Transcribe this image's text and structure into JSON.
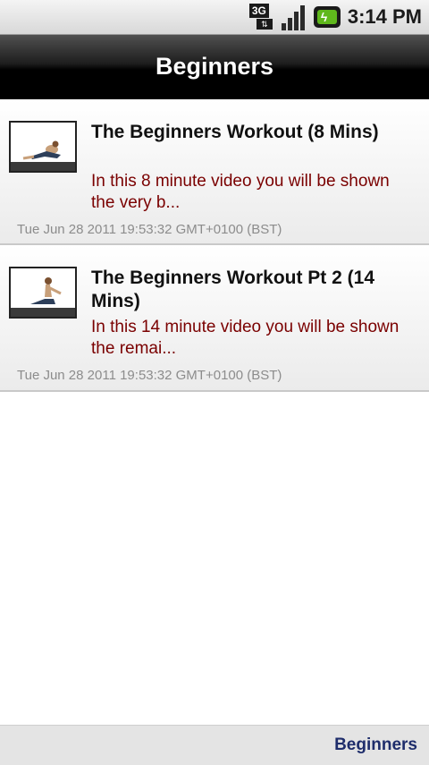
{
  "status_bar": {
    "network_type": "3G",
    "time": "3:14 PM",
    "icons": [
      "3g-data-icon",
      "signal-strength-icon",
      "battery-charging-icon"
    ]
  },
  "header": {
    "title": "Beginners"
  },
  "videos": [
    {
      "title": "The Beginners Workout (8 Mins)",
      "description": "In this 8 minute video you will be shown the very b...",
      "date": "Tue Jun 28 2011 19:53:32 GMT+0100 (BST)"
    },
    {
      "title": "The Beginners Workout Pt 2 (14 Mins)",
      "description": "In this 14 minute video you will be shown the remai...",
      "date": "Tue Jun 28 2011 19:53:32 GMT+0100 (BST)"
    }
  ],
  "footer": {
    "link_label": "Beginners"
  },
  "colors": {
    "description_text": "#7a0000",
    "date_text": "#8c8c8c",
    "footer_link": "#1e2d6b",
    "header_bg": "#000000"
  }
}
